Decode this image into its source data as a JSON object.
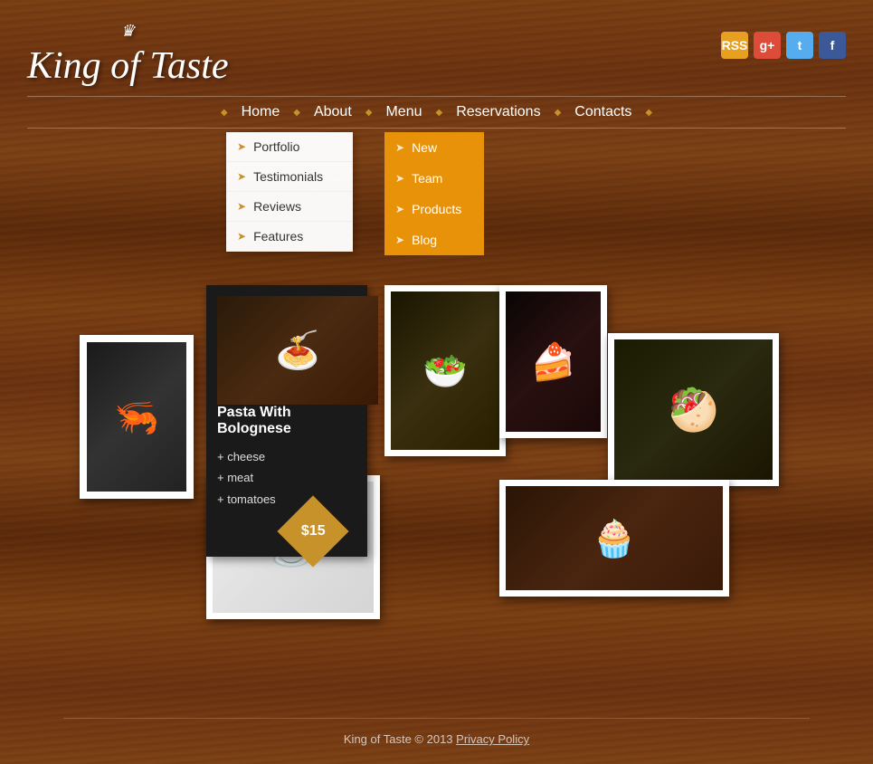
{
  "site": {
    "title": "King of Taste",
    "crown": "♛",
    "copyright": "King of Taste © 2013",
    "privacy_policy": "Privacy Policy"
  },
  "social": {
    "rss_label": "RSS",
    "gplus_label": "g+",
    "twitter_label": "t",
    "facebook_label": "f"
  },
  "nav": {
    "items": [
      {
        "label": "Home",
        "active": false
      },
      {
        "label": "About",
        "active": true,
        "has_dropdown": true
      },
      {
        "label": "Menu",
        "active": false
      },
      {
        "label": "Reservations",
        "active": false,
        "has_dropdown": true
      },
      {
        "label": "Contacts",
        "active": false
      }
    ]
  },
  "about_dropdown": {
    "items": [
      {
        "label": "Portfolio"
      },
      {
        "label": "Testimonials"
      },
      {
        "label": "Reviews"
      },
      {
        "label": "Features"
      }
    ]
  },
  "reservations_dropdown": {
    "items": [
      {
        "label": "New"
      },
      {
        "label": "Team"
      },
      {
        "label": "Products"
      },
      {
        "label": "Blog"
      }
    ]
  },
  "featured_dish": {
    "title": "Pasta With Bolognese",
    "ingredients": [
      "cheese",
      "meat",
      "tomatoes"
    ],
    "price": "$15"
  },
  "footer": {
    "text": "King of Taste © 2013 Privacy Policy"
  }
}
